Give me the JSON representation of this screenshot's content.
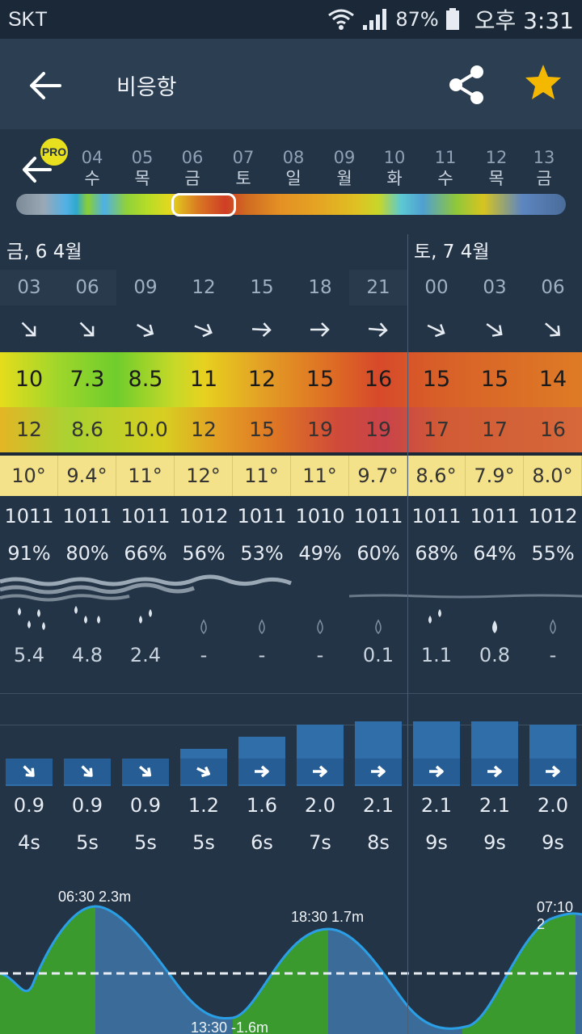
{
  "status": {
    "carrier": "SKT",
    "battery": "87%",
    "time": "오후 3:31"
  },
  "header": {
    "title": "비응항"
  },
  "pro_label": "PRO",
  "dates": [
    {
      "day": "04",
      "weekday": "수"
    },
    {
      "day": "05",
      "weekday": "목"
    },
    {
      "day": "06",
      "weekday": "금"
    },
    {
      "day": "07",
      "weekday": "토"
    },
    {
      "day": "08",
      "weekday": "일"
    },
    {
      "day": "09",
      "weekday": "월"
    },
    {
      "day": "10",
      "weekday": "화"
    },
    {
      "day": "11",
      "weekday": "수"
    },
    {
      "day": "12",
      "weekday": "목"
    },
    {
      "day": "13",
      "weekday": "금"
    }
  ],
  "day_headers": {
    "friday": "금, 6 4월",
    "saturday": "토, 7 4월"
  },
  "hours": [
    "03",
    "06",
    "09",
    "12",
    "15",
    "18",
    "21",
    "00",
    "03",
    "06"
  ],
  "wind": [
    "10",
    "7.3",
    "8.5",
    "11",
    "12",
    "15",
    "16",
    "15",
    "15",
    "14"
  ],
  "gust": [
    "12",
    "8.6",
    "10.0",
    "12",
    "15",
    "19",
    "19",
    "17",
    "17",
    "16"
  ],
  "temperature": [
    "10°",
    "9.4°",
    "11°",
    "12°",
    "11°",
    "11°",
    "9.7°",
    "8.6°",
    "7.9°",
    "8.0°"
  ],
  "pressure": [
    "1011",
    "1011",
    "1011",
    "1012",
    "1011",
    "1010",
    "1011",
    "1011",
    "1011",
    "1012"
  ],
  "humidity": [
    "91%",
    "80%",
    "66%",
    "56%",
    "53%",
    "49%",
    "60%",
    "68%",
    "64%",
    "55%"
  ],
  "rain": [
    "5.4",
    "4.8",
    "2.4",
    "-",
    "-",
    "-",
    "0.1",
    "1.1",
    "0.8",
    "-"
  ],
  "wave_height": [
    "0.9",
    "0.9",
    "0.9",
    "1.2",
    "1.6",
    "2.0",
    "2.1",
    "2.1",
    "2.1",
    "2.0"
  ],
  "wave_period": [
    "4s",
    "5s",
    "5s",
    "5s",
    "6s",
    "7s",
    "8s",
    "9s",
    "9s",
    "9s"
  ],
  "tides": {
    "high1": "06:30 2.3m",
    "low1": "13:30 -1.6m",
    "high2": "18:30 1.7m",
    "high3": "07:10 2"
  },
  "colors": {
    "accent": "#f5b800",
    "wave_bar": "#2f6ea8",
    "tide_green": "#3a9a2e",
    "tide_blue": "#3b6c99"
  }
}
